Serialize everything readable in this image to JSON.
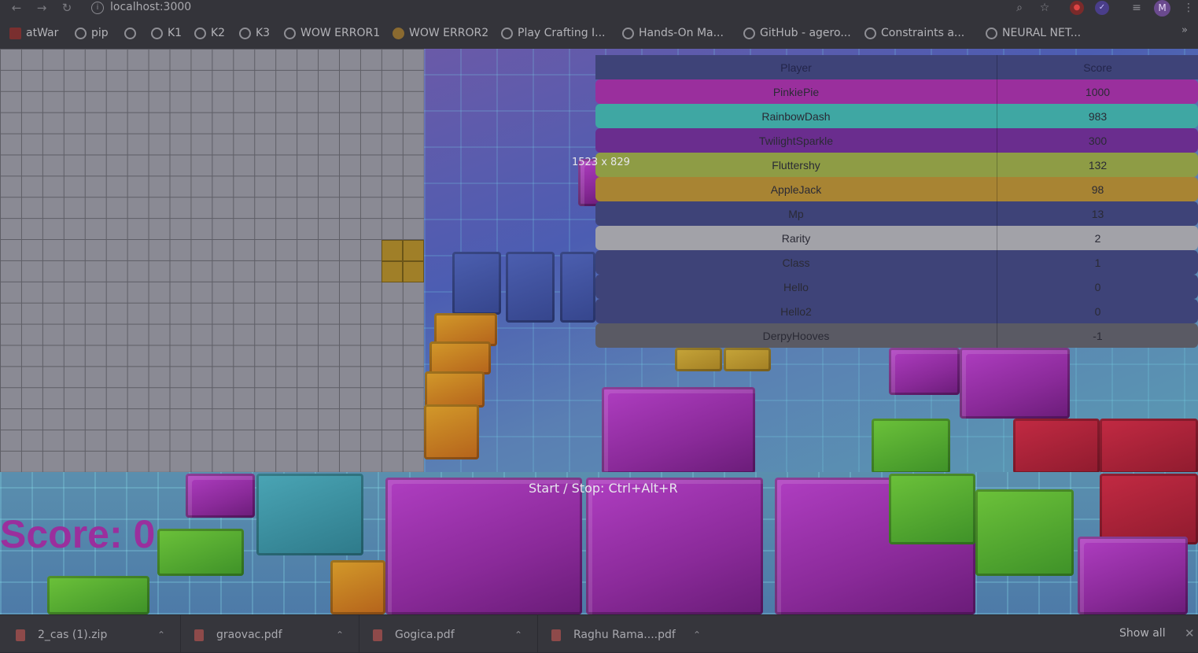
{
  "browser": {
    "url": "localhost:3000",
    "icons": [
      "back-icon",
      "forward-icon",
      "reload-icon",
      "info-icon",
      "zoom-icon",
      "star-icon",
      "extension-red-icon",
      "extension-purple-icon",
      "playlist-icon",
      "profile-avatar",
      "kebab-menu-icon"
    ],
    "avatar_initial": "M",
    "bookmarks_more": "»",
    "bookmarks": [
      {
        "label": "atWar"
      },
      {
        "label": "pip"
      },
      {
        "label": ""
      },
      {
        "label": "K1"
      },
      {
        "label": "K2"
      },
      {
        "label": "K3"
      },
      {
        "label": "WOW ERROR1"
      },
      {
        "label": "WOW ERROR2"
      },
      {
        "label": "Play Crafting I..."
      },
      {
        "label": "Hands-On Ma..."
      },
      {
        "label": "GitHub - agero..."
      },
      {
        "label": "Constraints a..."
      },
      {
        "label": "NEURAL NET..."
      }
    ]
  },
  "game": {
    "score_text": "Score: 0",
    "hint": "Start / Stop: Ctrl+Alt+R",
    "dimension_label": "1523 x 829",
    "leaderboard": {
      "headers": {
        "player": "Player",
        "score": "Score"
      },
      "rows": [
        {
          "player": "PinkiePie",
          "score": "1000",
          "color": "#9a2f9d"
        },
        {
          "player": "RainbowDash",
          "score": "983",
          "color": "#3fa7a3"
        },
        {
          "player": "TwilightSparkle",
          "score": "300",
          "color": "#6a2d8e"
        },
        {
          "player": "Fluttershy",
          "score": "132",
          "color": "#8e9c45"
        },
        {
          "player": "AppleJack",
          "score": "98",
          "color": "#a88433"
        },
        {
          "player": "Mp",
          "score": "13",
          "color": "#3e4378"
        },
        {
          "player": "Rarity",
          "score": "2",
          "color": "#a2a2a8"
        },
        {
          "player": "Class",
          "score": "1",
          "color": "#3e4378"
        },
        {
          "player": "Hello",
          "score": "0",
          "color": "#3e4378"
        },
        {
          "player": "Hello2",
          "score": "0",
          "color": "#3e4378"
        },
        {
          "player": "DerpyHooves",
          "score": "-1",
          "color": "#5a5a64"
        }
      ]
    }
  },
  "downloads": {
    "items": [
      {
        "name": "2_cas (1).zip"
      },
      {
        "name": "graovac.pdf"
      },
      {
        "name": "Gogica.pdf"
      },
      {
        "name": "Raghu Rama....pdf"
      }
    ],
    "show_all": "Show all",
    "close_glyph": "✕"
  }
}
